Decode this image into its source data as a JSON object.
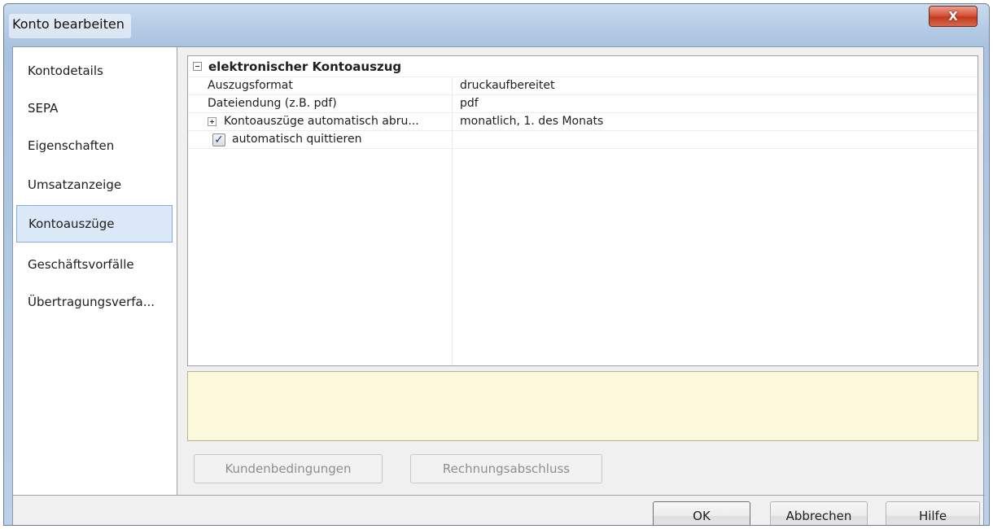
{
  "window": {
    "title": "Konto bearbeiten",
    "close_label": "X"
  },
  "sidebar": {
    "items": [
      {
        "label": "Kontodetails"
      },
      {
        "label": "SEPA"
      },
      {
        "label": "Eigenschaften"
      },
      {
        "label": "Umsatzanzeige"
      },
      {
        "label": "Kontoauszüge"
      },
      {
        "label": "Geschäftsvorfälle"
      },
      {
        "label": "Übertragungsverfa..."
      }
    ],
    "selected": "Kontoauszüge"
  },
  "grid": {
    "category": "elektronischer Kontoauszug",
    "rows": [
      {
        "name": "Auszugsformat",
        "value": "druckaufbereitet"
      },
      {
        "name": "Dateiendung (z.B. pdf)",
        "value": "pdf"
      },
      {
        "name": "Kontoauszüge automatisch abru...",
        "value": "monatlich, 1. des Monats"
      },
      {
        "name": "automatisch quittieren",
        "checked": true
      }
    ],
    "check_glyph": "✓"
  },
  "buttons": {
    "kundenbedingungen": "Kundenbedingungen",
    "rechnungsabschluss": "Rechnungsabschluss",
    "ok": "OK",
    "abbrechen": "Abbrechen",
    "hilfe": "Hilfe"
  },
  "colors": {
    "selection_bg": "#dbe8f8",
    "description_bg": "#fbf8dc",
    "close_button": "#c23a1f"
  }
}
